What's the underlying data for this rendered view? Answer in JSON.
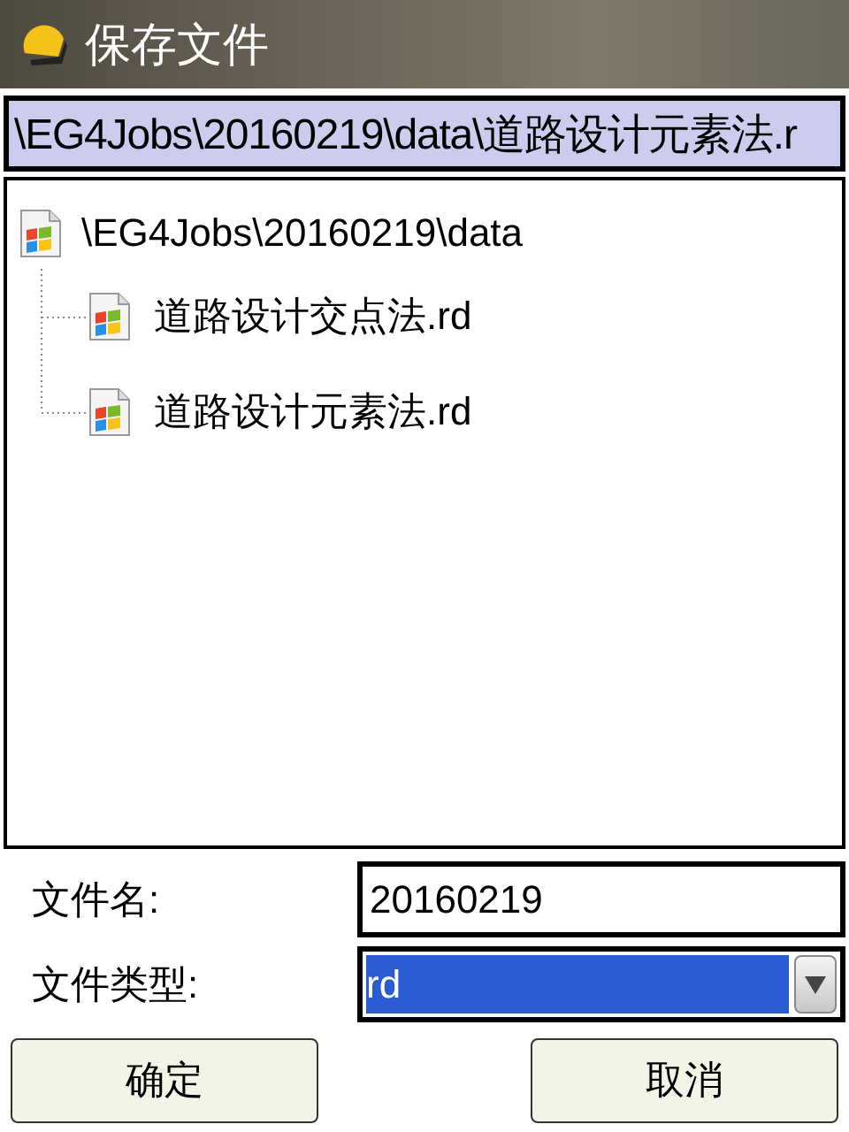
{
  "window": {
    "title": "保存文件"
  },
  "path": {
    "value": "\\EG4Jobs\\20160219\\data\\道路设计元素法.r"
  },
  "tree": {
    "label": "\\EG4Jobs\\20160219\\data",
    "children": [
      {
        "label": "道路设计交点法.rd"
      },
      {
        "label": "道路设计元素法.rd"
      }
    ]
  },
  "file_name": {
    "label": "文件名:",
    "value": "20160219"
  },
  "file_type": {
    "label": "文件类型:",
    "value": "rd",
    "highlighted": true
  },
  "buttons": [
    "确定",
    "取消"
  ]
}
